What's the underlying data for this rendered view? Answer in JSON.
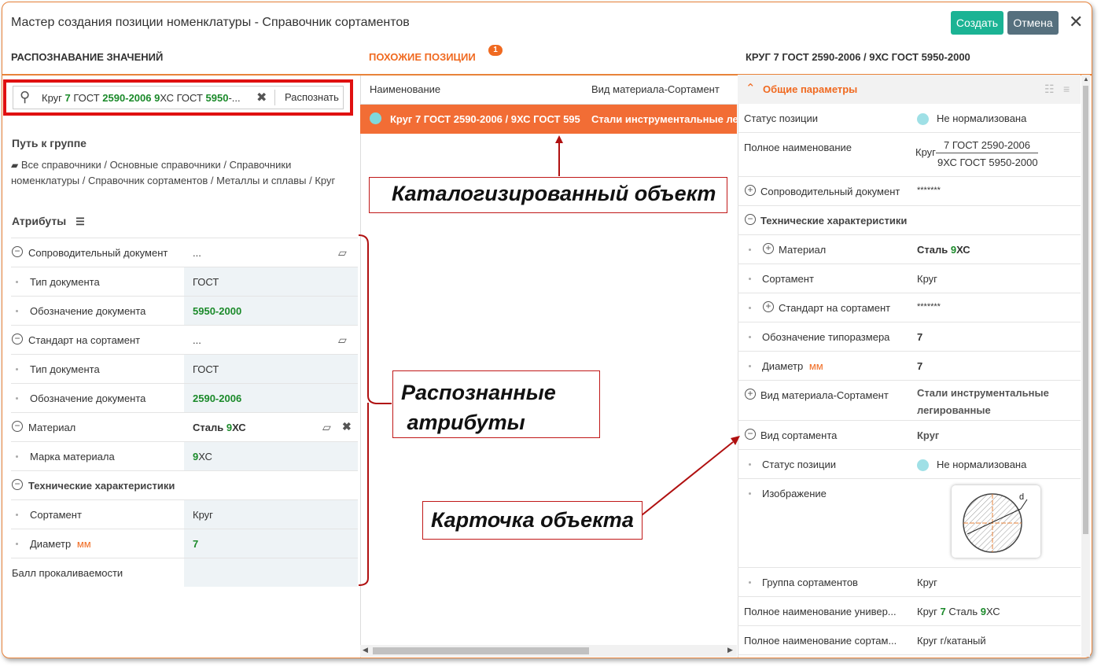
{
  "window": {
    "title": "Мастер создания позиции номенклатуры - Справочник сортаментов",
    "create_label": "Создать",
    "cancel_label": "Отмена"
  },
  "left": {
    "header": "РАСПОЗНАВАНИЕ ЗНАЧЕНИЙ",
    "search_parts": [
      "Круг ",
      "7",
      " ГОСТ ",
      "2590",
      "-",
      "2006",
      " ",
      "9",
      "ХС ГОСТ ",
      "5950",
      "-..."
    ],
    "recognize_label": "Распознать",
    "path_label": "Путь к группе",
    "path_text": "Все справочники / Основные справочники / Справочники номенклатуры / Справочник сортаментов / Металлы и сплавы / Круг",
    "attributes_label": "Атрибуты",
    "rows": {
      "r1": {
        "k": "Сопроводительный документ",
        "v": "..."
      },
      "r2": {
        "k": "Тип документа",
        "v": "ГОСТ"
      },
      "r3": {
        "k": "Обозначение документа",
        "v": "5950-2000"
      },
      "r4": {
        "k": "Стандарт на сортамент",
        "v": "..."
      },
      "r5": {
        "k": "Тип документа",
        "v": "ГОСТ"
      },
      "r6": {
        "k": "Обозначение документа",
        "v": "2590-2006"
      },
      "r7": {
        "k": "Материал",
        "v1": "Сталь ",
        "v2": "9",
        "v3": "ХС"
      },
      "r8": {
        "k": "Марка материала",
        "v1": "9",
        "v2": "ХС"
      },
      "r9": {
        "k": "Технические характеристики"
      },
      "r10": {
        "k": "Сортамент",
        "v": "Круг"
      },
      "r11": {
        "k": "Диаметр",
        "unit": "мм",
        "v": "7"
      },
      "r12": {
        "k": "Балл прокаливаемости",
        "v": ""
      }
    }
  },
  "middle": {
    "header": "ПОХОЖИЕ ПОЗИЦИИ",
    "badge": "1",
    "col_name": "Наименование",
    "col_type": "Вид материала-Сортамент",
    "row_name": "Круг 7 ГОСТ 2590-2006 / 9ХС ГОСТ 595",
    "row_type": "Стали инструментальные легированные"
  },
  "callouts": {
    "catalog": "Каталогизированный объект",
    "recognized_1": "Распознанные",
    "recognized_2": " атрибуты",
    "card": "Карточка объекта"
  },
  "right": {
    "header": "КРУГ 7 ГОСТ 2590-2006 / 9ХС ГОСТ 5950-2000",
    "section": "Общие параметры",
    "status_k": "Статус позиции",
    "status_v": "Не нормализована",
    "fullname_k": "Полное наименование",
    "fullname_prefix": "Круг",
    "fullname_num": "7 ГОСТ 2590-2006",
    "fullname_den": "9ХС ГОСТ 5950-2000",
    "doc_k": "Сопроводительный документ",
    "doc_v": "*******",
    "tech_k": "Технические характеристики",
    "mat_k": "Материал",
    "mat_v1": "Сталь ",
    "mat_v2": "9",
    "mat_v3": "ХС",
    "sort_k": "Сортамент",
    "sort_v": "Круг",
    "std_k": "Стандарт на сортамент",
    "std_v": "*******",
    "size_k": "Обозначение типоразмера",
    "size_v": "7",
    "diam_k": "Диаметр",
    "diam_unit": "мм",
    "diam_v": "7",
    "type_k": "Вид материала-Сортамент",
    "type_v1": "Стали инструментальные",
    "type_v2": "легированные",
    "kind_k": "Вид сортамента",
    "kind_v": "Круг",
    "status2_k": "Статус позиции",
    "status2_v": "Не нормализована",
    "img_k": "Изображение",
    "img_d": "d",
    "group_k": "Группа сортаментов",
    "group_v": "Круг",
    "univ_k": "Полное наименование универ...",
    "univ_v1": "Круг ",
    "univ_v2": "7",
    "univ_v3": " Сталь ",
    "univ_v4": "9",
    "univ_v5": "ХС",
    "sortfull_k": "Полное наименование сортам...",
    "sortfull_v": "Круг г/катаный"
  }
}
